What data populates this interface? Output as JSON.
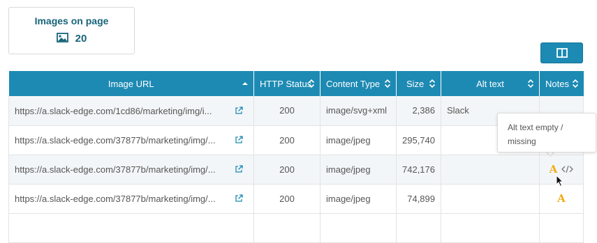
{
  "stats": {
    "title": "Images on page",
    "icon": "image-icon",
    "count": "20"
  },
  "layout_button": {
    "icon": "columns-icon"
  },
  "table": {
    "columns": [
      {
        "label": "Image URL",
        "sort": "ascending"
      },
      {
        "label": "HTTP Status",
        "sort": "unsorted"
      },
      {
        "label": "Content Type",
        "sort": "unsorted"
      },
      {
        "label": "Size",
        "sort": "unsorted"
      },
      {
        "label": "Alt text",
        "sort": "unsorted"
      },
      {
        "label": "Notes",
        "sort": "unsorted"
      }
    ],
    "rows": [
      {
        "url": "https://a.slack-edge.com/1cd86/marketing/img/i...",
        "status": "200",
        "type": "image/svg+xml",
        "size": "2,386",
        "alt": "Slack",
        "notes": []
      },
      {
        "url": "https://a.slack-edge.com/37877b/marketing/img/...",
        "status": "200",
        "type": "image/jpeg",
        "size": "295,740",
        "alt": "",
        "notes": []
      },
      {
        "url": "https://a.slack-edge.com/37877b/marketing/img/...",
        "status": "200",
        "type": "image/jpeg",
        "size": "742,176",
        "alt": "",
        "notes": [
          "alt-warning-icon",
          "code-icon"
        ]
      },
      {
        "url": "https://a.slack-edge.com/37877b/marketing/img/...",
        "status": "200",
        "type": "image/jpeg",
        "size": "74,899",
        "alt": "",
        "notes": [
          "alt-warning-icon"
        ]
      }
    ]
  },
  "tooltip": {
    "text": "Alt text empty / missing"
  },
  "colors": {
    "accent": "#1d8ab3",
    "heading": "#176479",
    "warning": "#f0ac14"
  }
}
